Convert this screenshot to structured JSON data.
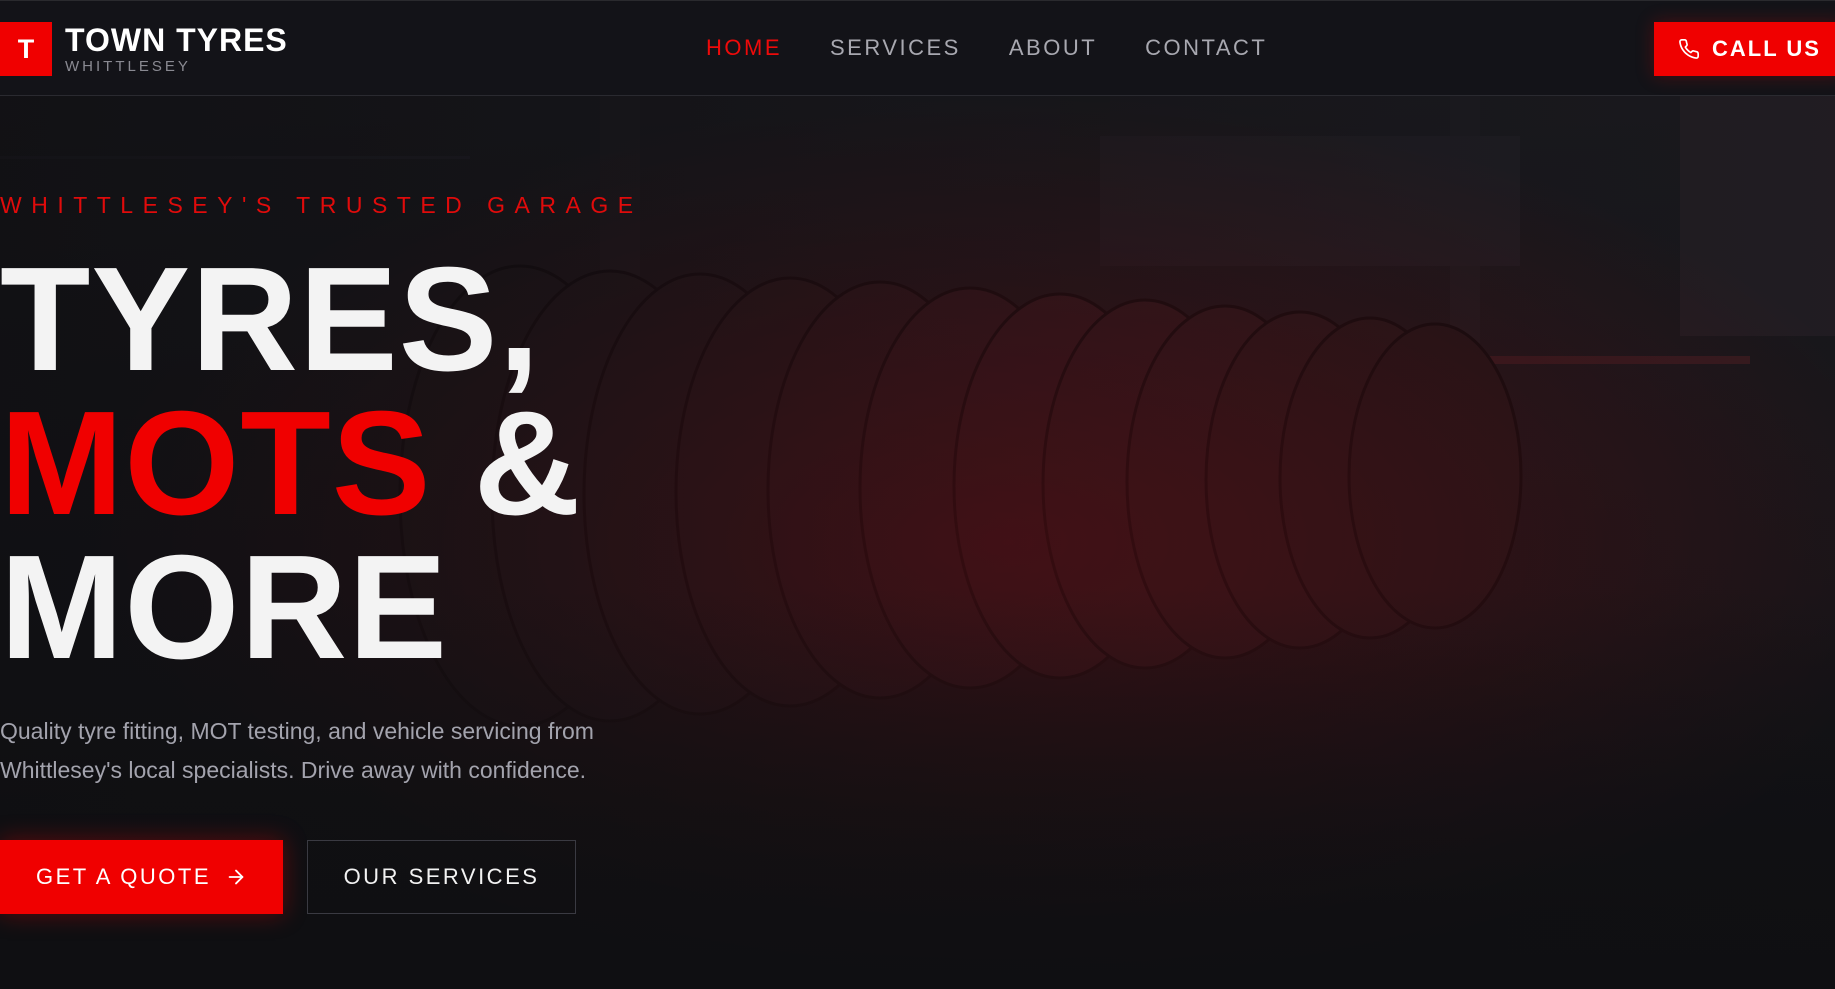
{
  "brand": {
    "mark": "T",
    "name": "TOWN TYRES",
    "location": "WHITTLESEY"
  },
  "nav": {
    "items": [
      {
        "label": "HOME",
        "active": true
      },
      {
        "label": "SERVICES",
        "active": false
      },
      {
        "label": "ABOUT",
        "active": false
      },
      {
        "label": "CONTACT",
        "active": false
      }
    ]
  },
  "call_button": {
    "label": "CALL US",
    "icon": "phone-icon"
  },
  "hero": {
    "eyebrow": "WHITTLESEY'S TRUSTED GARAGE",
    "headline": {
      "line1": "TYRES,",
      "line2_accent": "MOTS",
      "line2_rest": " &",
      "line3": "MORE"
    },
    "description": "Quality tyre fitting, MOT testing, and vehicle servicing from Whittlesey's local specialists. Drive away with confidence.",
    "primary_button": {
      "label": "GET A QUOTE",
      "icon": "arrow-right-icon"
    },
    "secondary_button": {
      "label": "OUR SERVICES"
    }
  },
  "colors": {
    "accent": "#f00000",
    "background": "#0f0f12",
    "header": "#131318",
    "text": "#f3f3f3",
    "muted": "#a3a3ad"
  }
}
